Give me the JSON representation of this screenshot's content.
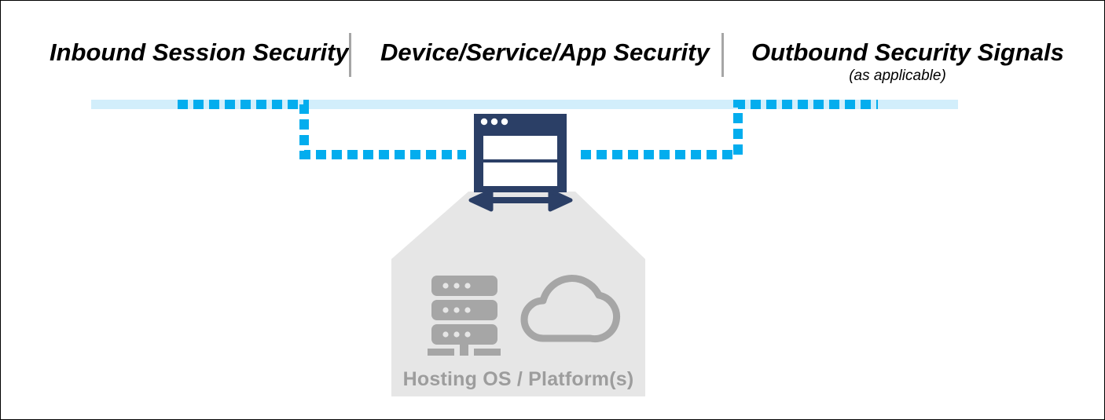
{
  "diagram": {
    "title_columns": [
      {
        "label": "Inbound Session Security",
        "sublabel": ""
      },
      {
        "label": "Device/Service/App Security",
        "sublabel": ""
      },
      {
        "label": "Outbound Security Signals",
        "sublabel": "(as applicable)"
      }
    ],
    "platform_box": {
      "label": "Hosting OS / Platform(s)",
      "icons": [
        "server-rack-icon",
        "cloud-icon"
      ]
    },
    "center_node": {
      "icon": "browser-window-icon",
      "window_dots": 3,
      "panels": 2,
      "arrow": "bidirectional-arrow-icon"
    },
    "flow": {
      "session_band": "inbound-outbound-session-band",
      "dashed_path": "security-signal-dashed-path"
    },
    "colors": {
      "band_light_blue": "#d2eefb",
      "dash_blue": "#03adee",
      "navy": "#2b3f66",
      "platform_fill": "#e6e6e6",
      "trapezoid_fill": "#e6e6e6",
      "icon_gray": "#a6a6a6",
      "label_gray": "#9d9d9d",
      "divider_gray": "#a6a6a6",
      "border_black": "#000000",
      "text_black": "#000000"
    }
  }
}
